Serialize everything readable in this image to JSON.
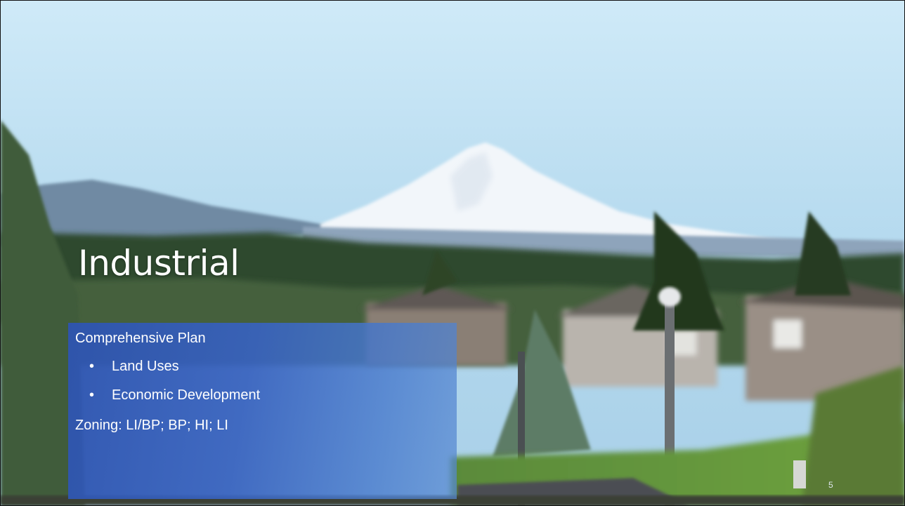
{
  "slide": {
    "title": "Industrial",
    "panel": {
      "heading": "Comprehensive Plan",
      "bullets": [
        "Land Uses",
        "Economic Development"
      ],
      "zoning": "Zoning: LI/BP; BP; HI; LI"
    },
    "page_number": "5"
  },
  "colors": {
    "panel_blue": "#3558b0",
    "sky": "#b9ddf1",
    "snow": "#ffffff",
    "forest": "#2f4a2c"
  }
}
